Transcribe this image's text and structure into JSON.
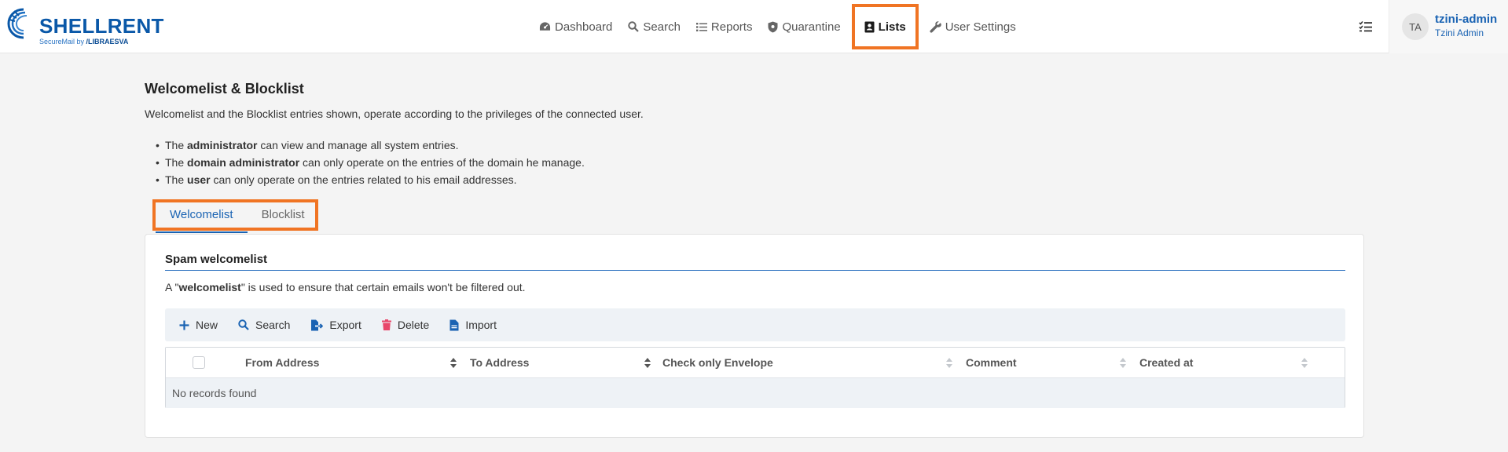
{
  "brand": {
    "name": "SHELLRENT",
    "sub_prefix": "SecureMail by",
    "sub_vendor": "/LIBRAESVA",
    "primary_color": "#0a58a8",
    "accent_color": "#f07423"
  },
  "nav": {
    "items": [
      {
        "label": "Dashboard",
        "icon": "dashboard-icon"
      },
      {
        "label": "Search",
        "icon": "search-icon"
      },
      {
        "label": "Reports",
        "icon": "list-icon"
      },
      {
        "label": "Quarantine",
        "icon": "shield-icon"
      },
      {
        "label": "Lists",
        "icon": "contact-book-icon",
        "active": true
      },
      {
        "label": "User Settings",
        "icon": "wrench-icon"
      }
    ]
  },
  "user": {
    "initials": "TA",
    "username": "tzini-admin",
    "role": "Tzini Admin"
  },
  "page": {
    "title": "Welcomelist & Blocklist",
    "intro": "Welcomelist and the Blocklist entries shown, operate according to the privileges of the connected user.",
    "rules": [
      {
        "pre": "The ",
        "strong": "administrator",
        "post": " can view and manage all system entries."
      },
      {
        "pre": "The ",
        "strong": "domain administrator",
        "post": " can only operate on the entries of the domain he manage."
      },
      {
        "pre": "The ",
        "strong": "user",
        "post": " can only operate on the entries related to his email addresses."
      }
    ]
  },
  "tabs": [
    {
      "label": "Welcomelist",
      "active": true
    },
    {
      "label": "Blocklist",
      "active": false
    }
  ],
  "card": {
    "title": "Spam welcomelist",
    "desc_pre": "A \"",
    "desc_strong": "welcomelist",
    "desc_post": "\" is used to ensure that certain emails won't be filtered out."
  },
  "toolbar": {
    "new": "New",
    "search": "Search",
    "export": "Export",
    "delete": "Delete",
    "import": "Import"
  },
  "table": {
    "columns": [
      "From Address",
      "To Address",
      "Check only Envelope",
      "Comment",
      "Created at"
    ],
    "empty_message": "No records found"
  }
}
